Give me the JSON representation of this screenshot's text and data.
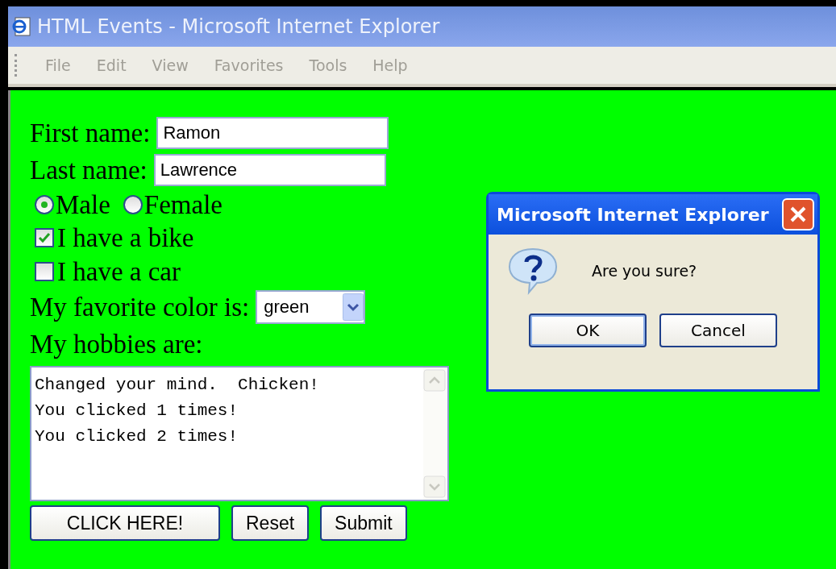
{
  "window": {
    "title": "HTML Events - Microsoft Internet Explorer"
  },
  "menu": [
    "File",
    "Edit",
    "View",
    "Favorites",
    "Tools",
    "Help"
  ],
  "text_fields": [
    {
      "label": "First name:",
      "value": "Ramon"
    },
    {
      "label": "Last name:",
      "value": "Lawrence"
    }
  ],
  "radios": [
    {
      "label": "Male",
      "selected": true
    },
    {
      "label": "Female",
      "selected": false
    }
  ],
  "checkboxes": [
    {
      "label": "I have a bike",
      "checked": true
    },
    {
      "label": "I have a car",
      "checked": false
    }
  ],
  "color_select": {
    "label": "My favorite color is:",
    "value": "green"
  },
  "hobbies": {
    "label": "My hobbies are:",
    "lines": [
      "Changed your mind.  Chicken!",
      "You clicked 1 times!",
      "You clicked 2 times!"
    ]
  },
  "buttons": [
    "CLICK HERE!",
    "Reset",
    "Submit"
  ],
  "dialog": {
    "title": "Microsoft Internet Explorer",
    "message": "Are you sure?",
    "buttons": [
      "OK",
      "Cancel"
    ]
  }
}
